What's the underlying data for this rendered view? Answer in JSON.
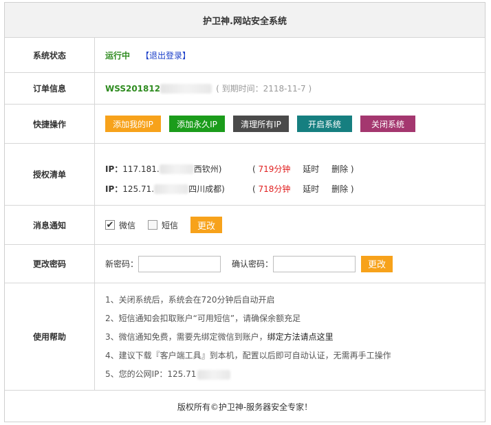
{
  "title": "护卫神.网站安全系统",
  "status": {
    "label": "系统状态",
    "value": "运行中",
    "logout": "【退出登录】"
  },
  "order": {
    "label": "订单信息",
    "number": "WSS201812",
    "expiry": "( 到期时间：2118-11-7 )"
  },
  "quick": {
    "label": "快捷操作",
    "buttons": [
      "添加我的IP",
      "添加永久IP",
      "清理所有IP",
      "开启系统",
      "关闭系统"
    ],
    "colors": {
      "orange": "#f7a21b",
      "green": "#1b9c1b",
      "dark": "#4a4a4a",
      "teal": "#167f80",
      "plum": "#a4376f"
    }
  },
  "auth": {
    "label": "授权清单",
    "items": [
      {
        "ip_label": "IP：",
        "ip": "117.181.",
        "location": "西钦州)",
        "open": "(",
        "minutes": "719分钟",
        "extend": "延时",
        "delete": "删除 )"
      },
      {
        "ip_label": "IP：",
        "ip": "125.71.",
        "location": "四川成都)",
        "open": "(",
        "minutes": "718分钟",
        "extend": "延时",
        "delete": "删除 )"
      }
    ]
  },
  "notify": {
    "label": "消息通知",
    "wechat": "微信",
    "sms": "短信",
    "change": "更改"
  },
  "password": {
    "label": "更改密码",
    "new_label": "新密码：",
    "confirm_label": "确认密码：",
    "change": "更改"
  },
  "help": {
    "label": "使用帮助",
    "lines": [
      "1、关闭系统后，系统会在720分钟后自动开启",
      "2、短信通知会扣取账户“可用短信”，请确保余额充足",
      "3、微信通知免费，需要先绑定微信到账户，",
      "4、建议下载『客户端工具』到本机，配置以后即可自动认证，无需再手工操作",
      "5、您的公网IP：125.71"
    ],
    "bind_link": "绑定方法请点这里"
  },
  "footer": "版权所有©护卫神-服务器安全专家！"
}
